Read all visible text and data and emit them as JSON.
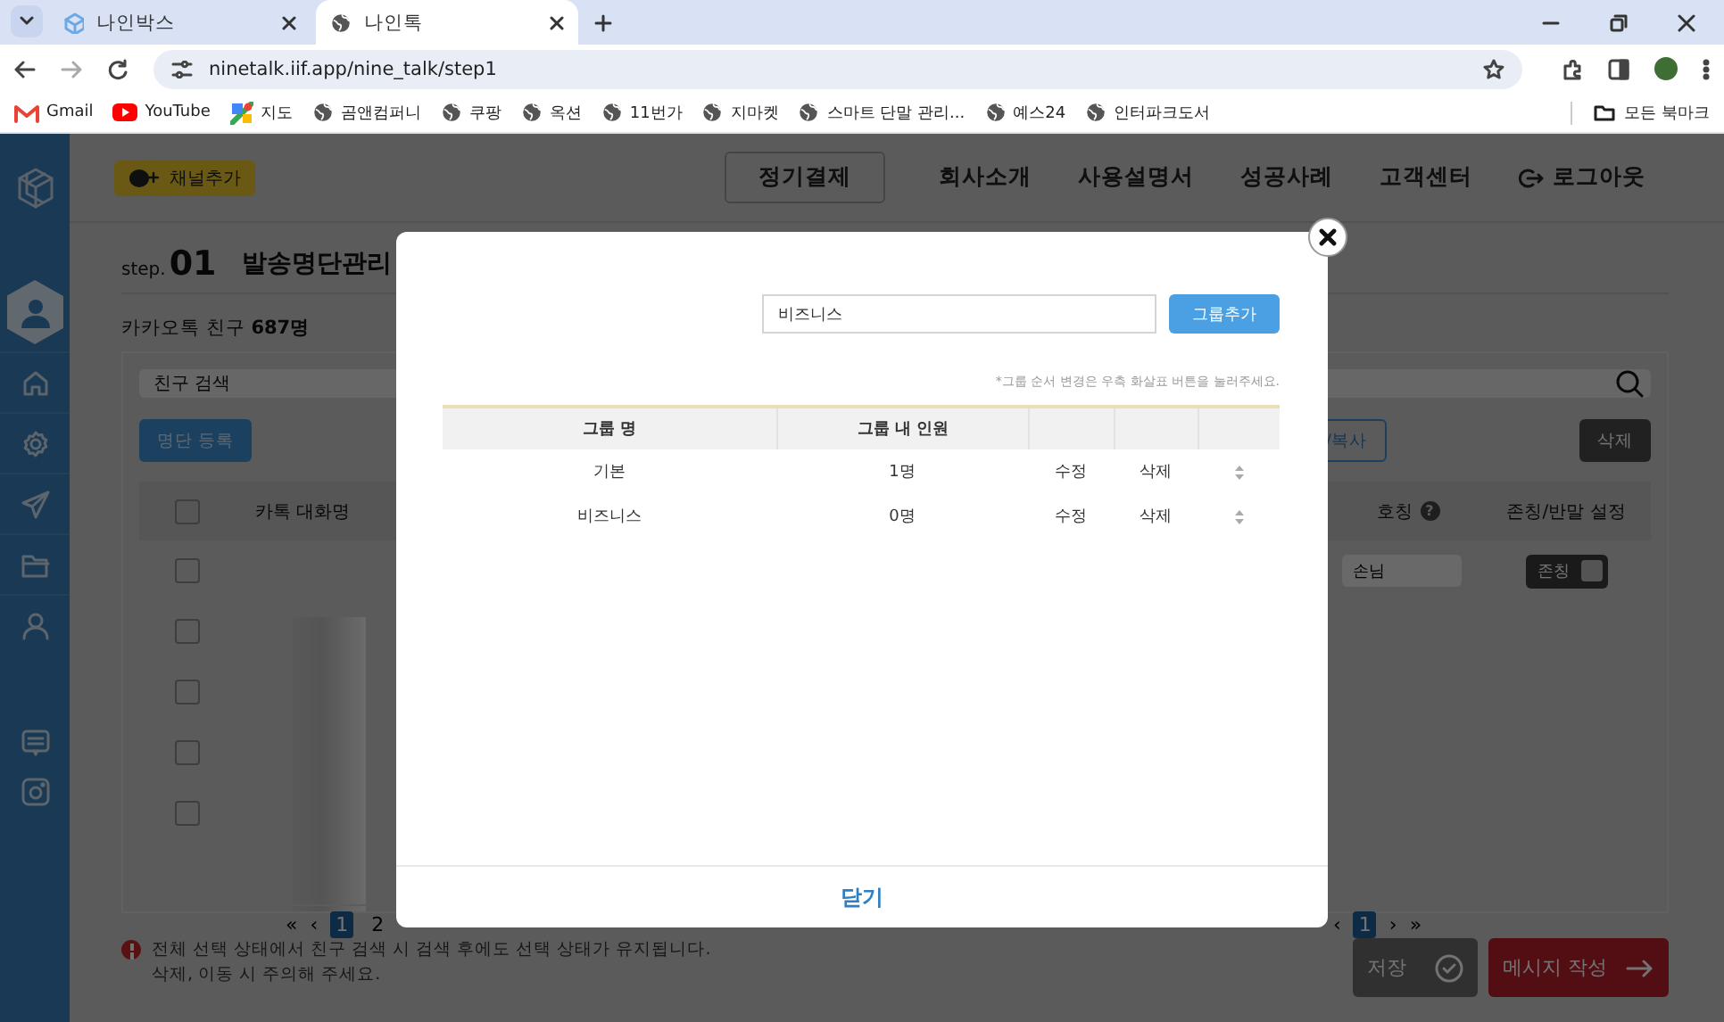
{
  "browser": {
    "tabs": [
      {
        "title": "나인박스",
        "kind": "app",
        "selected": false
      },
      {
        "title": "나인톡",
        "kind": "globe",
        "selected": true
      }
    ],
    "url": "ninetalk.iif.app/nine_talk/step1",
    "bookmarks": [
      {
        "label": "Gmail",
        "kind": "gmail"
      },
      {
        "label": "YouTube",
        "kind": "youtube"
      },
      {
        "label": "지도",
        "kind": "maps"
      },
      {
        "label": "곰앤컴퍼니",
        "kind": "globe"
      },
      {
        "label": "쿠팡",
        "kind": "globe"
      },
      {
        "label": "옥션",
        "kind": "globe"
      },
      {
        "label": "11번가",
        "kind": "globe"
      },
      {
        "label": "지마켓",
        "kind": "globe"
      },
      {
        "label": "스마트 단말 관리...",
        "kind": "globe"
      },
      {
        "label": "예스24",
        "kind": "globe"
      },
      {
        "label": "인터파크도서",
        "kind": "globe"
      }
    ],
    "all_bookmarks": "모든 북마크"
  },
  "sidebar": {
    "items": [
      {
        "kind": "profile",
        "selected": true
      },
      {
        "kind": "home",
        "selected": false
      },
      {
        "kind": "settings",
        "selected": false
      },
      {
        "kind": "send",
        "selected": false
      },
      {
        "kind": "folder",
        "selected": false
      },
      {
        "kind": "person",
        "selected": false
      },
      {
        "kind": "chat",
        "selected": false
      },
      {
        "kind": "instagram",
        "selected": false
      }
    ]
  },
  "header": {
    "channel_button": "채널추가",
    "nav": [
      {
        "label": "정기결제",
        "kind": "outlined"
      },
      {
        "label": "회사소개",
        "kind": "plain"
      },
      {
        "label": "사용설명서",
        "kind": "plain"
      },
      {
        "label": "성공사례",
        "kind": "plain"
      },
      {
        "label": "고객센터",
        "kind": "plain"
      },
      {
        "label": "로그아웃",
        "kind": "logout"
      }
    ]
  },
  "page": {
    "step_prefix": "step.",
    "step_number": "01",
    "title": "발송명단관리",
    "friend_count": "카카오톡 친구 **687명**",
    "search": {
      "placeholder": "친구 검색"
    },
    "register_button": "명단 등록",
    "copy_button": "/복사",
    "delete_button": "삭제",
    "left_table": {
      "columns": [
        "카톡 대화명"
      ],
      "rows": [
        {
          "checked": false
        },
        {
          "checked": false
        },
        {
          "checked": false
        },
        {
          "checked": false
        },
        {
          "checked": false
        }
      ],
      "header_checked": false,
      "pagination": [
        {
          "label": "«",
          "kind": "arrow",
          "selected": false
        },
        {
          "label": "‹",
          "kind": "arrow",
          "selected": false
        },
        {
          "label": "1",
          "kind": "page",
          "selected": true
        },
        {
          "label": "2",
          "kind": "page",
          "selected": false
        }
      ]
    },
    "right_table": {
      "columns": [
        "호칭",
        "존칭/반말 설정"
      ],
      "help_mark": "?",
      "rows": [
        {
          "title": "손님",
          "honorific": "존칭"
        }
      ],
      "pagination": [
        {
          "label": "‹",
          "kind": "arrow",
          "selected": false
        },
        {
          "label": "1",
          "kind": "page",
          "selected": true
        },
        {
          "label": "›",
          "kind": "arrow",
          "selected": false
        },
        {
          "label": "»",
          "kind": "arrow",
          "selected": false
        }
      ]
    },
    "notice": [
      "전체 선택 상태에서 친구 검색 시 검색 후에도 선택 상태가 유지됩니다.",
      "삭제, 이동 시 주의해 주세요."
    ],
    "save_button": "저장",
    "compose_button": "메시지 작성"
  },
  "modal": {
    "input": {
      "value": "비즈니스"
    },
    "add_button": "그룹추가",
    "hint": "*그룹 순서 변경은 우측 화살표 버튼을 눌러주세요.",
    "columns": [
      "그룹 명",
      "그룹 내 인원"
    ],
    "rows": [
      {
        "name": "기본",
        "members": "1명",
        "edit": "수정",
        "delete": "삭제"
      },
      {
        "name": "비즈니스",
        "members": "0명",
        "edit": "수정",
        "delete": "삭제"
      }
    ],
    "close_label": "닫기"
  }
}
